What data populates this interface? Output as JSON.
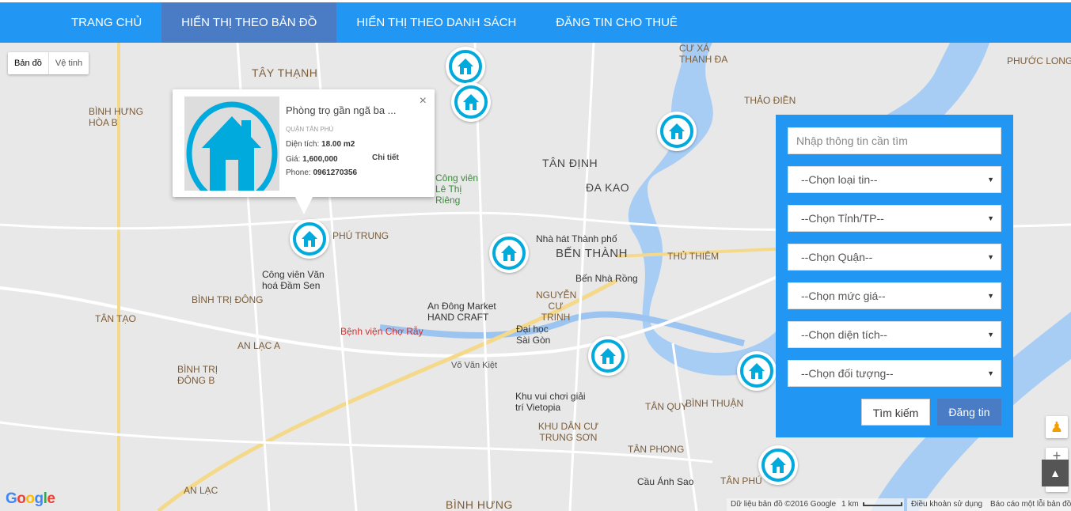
{
  "nav": {
    "items": [
      {
        "label": "TRANG CHỦ"
      },
      {
        "label": "HIỂN THỊ THEO BẢN ĐỒ"
      },
      {
        "label": "HIỂN THỊ THEO DANH SÁCH"
      },
      {
        "label": "ĐĂNG TIN CHO THUÊ"
      }
    ],
    "active_index": 1
  },
  "map_type": {
    "map": "Bản đồ",
    "satellite": "Vệ tinh"
  },
  "map_labels": [
    "TÂY THẠNH",
    "BÌNH HƯNG HÒA B",
    "TÂN ĐỊNH",
    "ĐA KAO",
    "BẾN THÀNH",
    "Nhà hát Thành phố",
    "Bến Nhà Rồng",
    "THỦ THIÊM",
    "NGUYỄN CƯ TRINH",
    "An Đông Market HAND CRAFT",
    "Bệnh viện Chợ Rẫy",
    "Đại học Sài Gòn",
    "Công viên Văn hoá Đầm Sen",
    "BÌNH TRỊ ĐÔNG",
    "TÂN TẠO",
    "AN LẠC A",
    "BÌNH TRỊ ĐÔNG B",
    "Võ Văn Kiệt",
    "Khu vui chơi giải trí Vietopia",
    "KHU DÂN CƯ TRUNG SƠN",
    "TÂN QUY",
    "BÌNH THUẬN",
    "TÂN PHONG",
    "Cầu Ánh Sao",
    "TÂN PHÚ",
    "BÌNH HƯNG",
    "AN LẠC",
    "THẢO ĐIỀN",
    "PHƯỚC LONG B",
    "CƯ XÁ THANH ĐA",
    "PHÚ TRUNG",
    "Công viên Lê Thị Riêng"
  ],
  "popup": {
    "title": "Phòng trọ gần ngã ba ...",
    "district": "QUẬN TÂN PHÚ",
    "area_label": "Diện tích:",
    "area": "18.00 m2",
    "price_label": "Giá:",
    "price": "1,600,000",
    "phone_label": "Phone:",
    "phone": "0961270356",
    "detail_link": "Chi tiết",
    "close": "×"
  },
  "search": {
    "placeholder": "Nhập thông tin cần tìm",
    "selects": [
      "--Chọn loại tin--",
      "--Chọn Tỉnh/TP--",
      "--Chọn Quận--",
      "--Chọn mức giá--",
      "--Chọn diện tích--",
      "--Chọn đối tượng--"
    ],
    "search_button": "Tìm kiếm",
    "post_button": "Đăng tin"
  },
  "footer": {
    "logo": "Google",
    "map_data": "Dữ liệu bản đồ ©2016 Google",
    "scale": "1 km",
    "terms": "Điều khoản sử dụng",
    "report": "Báo cáo một lỗi bản đồ"
  },
  "colors": {
    "nav": "#2196f3",
    "nav_active": "#4a7bc5",
    "marker": "#00aadd"
  }
}
